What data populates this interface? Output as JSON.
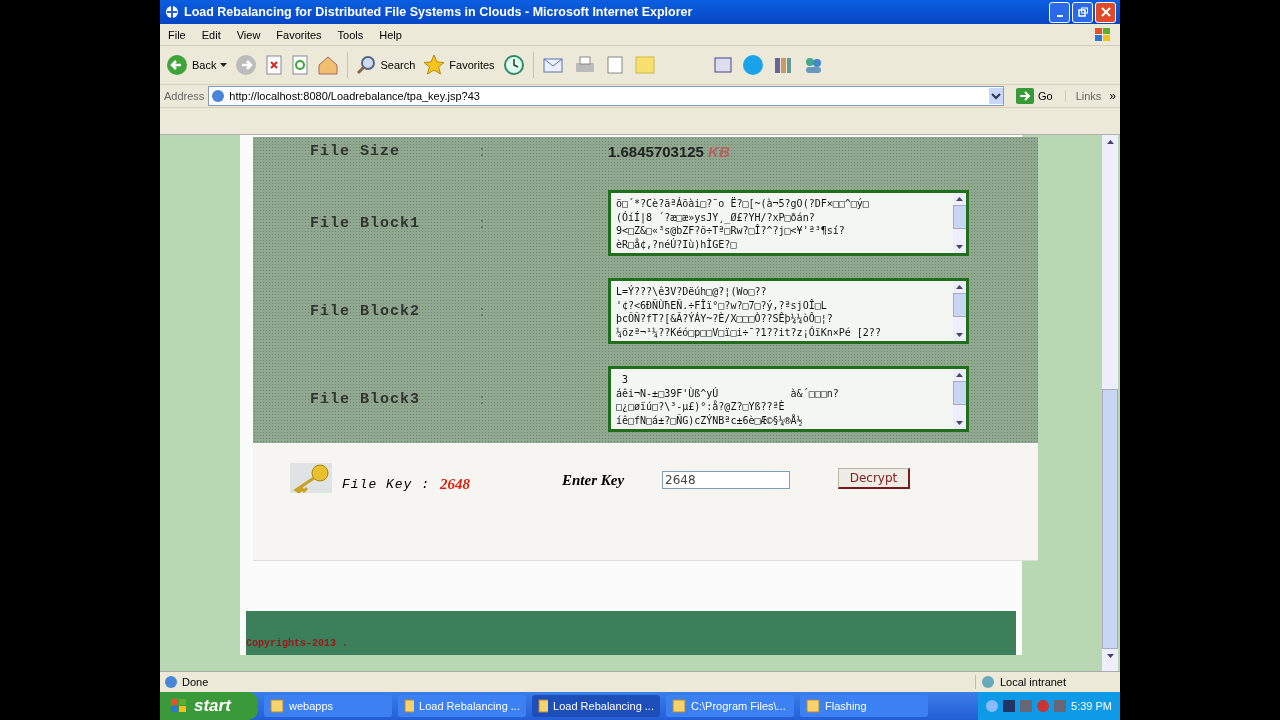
{
  "window": {
    "title": "Load Rebalancing for Distributed File Systems in Clouds - Microsoft Internet Explorer"
  },
  "menu": [
    "File",
    "Edit",
    "View",
    "Favorites",
    "Tools",
    "Help"
  ],
  "toolbar": {
    "back": "Back",
    "search": "Search",
    "favorites": "Favorites"
  },
  "address": {
    "label": "Address",
    "url": "http://localhost:8080/Loadrebalance/tpa_key.jsp?43",
    "go": "Go",
    "links": "Links",
    "more": "»"
  },
  "file_size": {
    "label": "File Size",
    "colon": ":",
    "value": "1.6845703125",
    "unit": "KB"
  },
  "blocks": [
    {
      "label": "File Block1",
      "colon": ":",
      "lines": [
        "ö□´*?Cè?ãªÁõài□?¯o Ë?□[~(à¬5?gO(?DF×□□^□ý□",
        "(ÓíÍ|8 ´?æ□æ»ysJY¸_Ø£?YH/?xP□ðán?",
        "9<□Z&□«³s@bZF?õ÷Tª□Rw?□Î?^?j□<¥'ª³¶sí?",
        "èR□å¢,?néÚ?Iù)hÌGE?□"
      ]
    },
    {
      "label": "File Block2",
      "colon": ":",
      "lines": [
        "L=Ý???\\ê3V?Dëúh□@?¦(Wo□??",
        "'¢?<6ÐÑÙħEÑ.÷FÎï°□?w?□7□?ý,?ªsjOÎ□L",
        "þcÕÑ?fT?[&Ã?ÝÁY~?È/X□□□Ò??SÊþ¼¼òÔ□¦?",
        "¼özª¬¹¼??Kéó□p□□V□ï□i÷¯?1??it?z¡ÓïKn×Pé [2??"
      ]
    },
    {
      "label": "File Block3",
      "colon": ":",
      "lines": [
        " 3",
        "áêi¬N-±□39F'Ùß^yÚ            à&´□□□n?",
        "□¿□øïú□?\\³-µ£)°:å?@Z?□Yß??ªÈ",
        "íê□fN□á±?□ÑG)cZÝNBªc±6è□Æ©§¼®Å½"
      ]
    }
  ],
  "key": {
    "label": "File Key :",
    "value": "2648"
  },
  "enter_key": {
    "label": "Enter Key",
    "value": "2648",
    "button": "Decrypt"
  },
  "footer": "Copyrights-2013 .",
  "status_bar": {
    "text": "Done",
    "zone": "Local intranet"
  },
  "taskbar": {
    "start": "start",
    "items": [
      {
        "label": "webapps",
        "selected": false
      },
      {
        "label": "Load Rebalancing ...",
        "selected": false
      },
      {
        "label": "Load Rebalancing ...",
        "selected": true
      },
      {
        "label": "C:\\Program Files\\...",
        "selected": false
      },
      {
        "label": "Flashing",
        "selected": false
      }
    ],
    "clock": "5:39 PM"
  }
}
